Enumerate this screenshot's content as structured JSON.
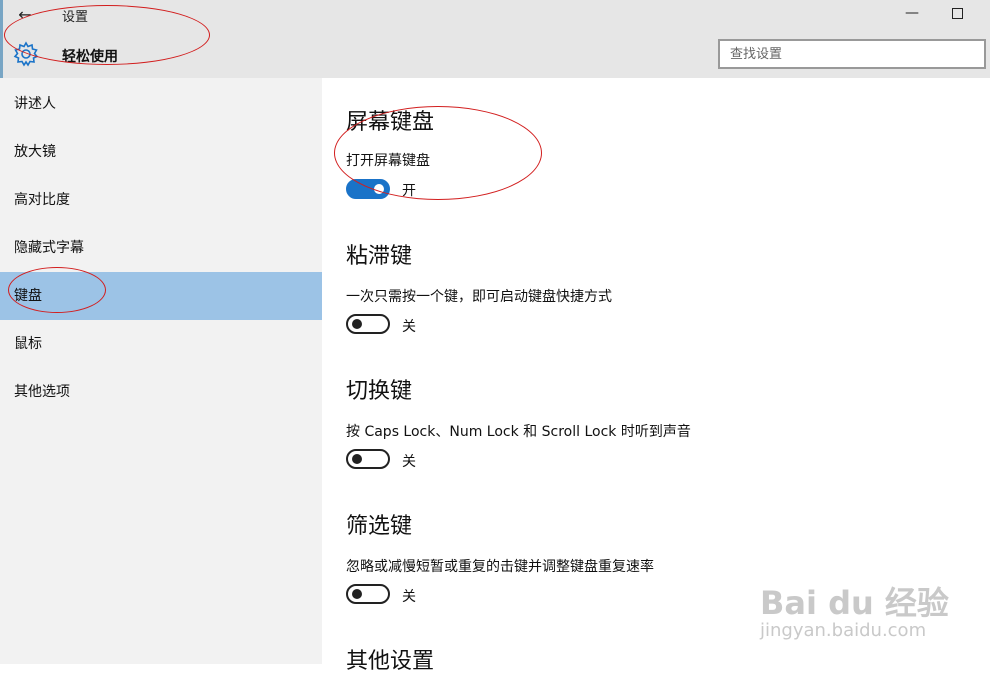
{
  "titlebar": {
    "back_label": "←",
    "app_title": "设置",
    "minimize_label": "—",
    "section_title": "轻松使用",
    "search_placeholder": "查找设置"
  },
  "sidebar": {
    "items": [
      {
        "label": "讲述人",
        "selected": false
      },
      {
        "label": "放大镜",
        "selected": false
      },
      {
        "label": "高对比度",
        "selected": false
      },
      {
        "label": "隐藏式字幕",
        "selected": false
      },
      {
        "label": "键盘",
        "selected": true
      },
      {
        "label": "鼠标",
        "selected": false
      },
      {
        "label": "其他选项",
        "selected": false
      }
    ]
  },
  "sections": [
    {
      "heading": "屏幕键盘",
      "description": "打开屏幕键盘",
      "toggle_state": "开",
      "on": true
    },
    {
      "heading": "粘滞键",
      "description": "一次只需按一个键，即可启动键盘快捷方式",
      "toggle_state": "关",
      "on": false
    },
    {
      "heading": "切换键",
      "description": "按 Caps Lock、Num Lock 和 Scroll Lock 时听到声音",
      "toggle_state": "关",
      "on": false
    },
    {
      "heading": "筛选键",
      "description": "忽略或减慢短暂或重复的击键并调整键盘重复速率",
      "toggle_state": "关",
      "on": false
    },
    {
      "heading": "其他设置"
    }
  ],
  "watermark": {
    "brand": "Bai du 经验",
    "url": "jingyan.baidu.com"
  },
  "colors": {
    "accent": "#1a73c8",
    "selected_nav": "#9cc3e6",
    "annotation": "#d21e1e"
  }
}
